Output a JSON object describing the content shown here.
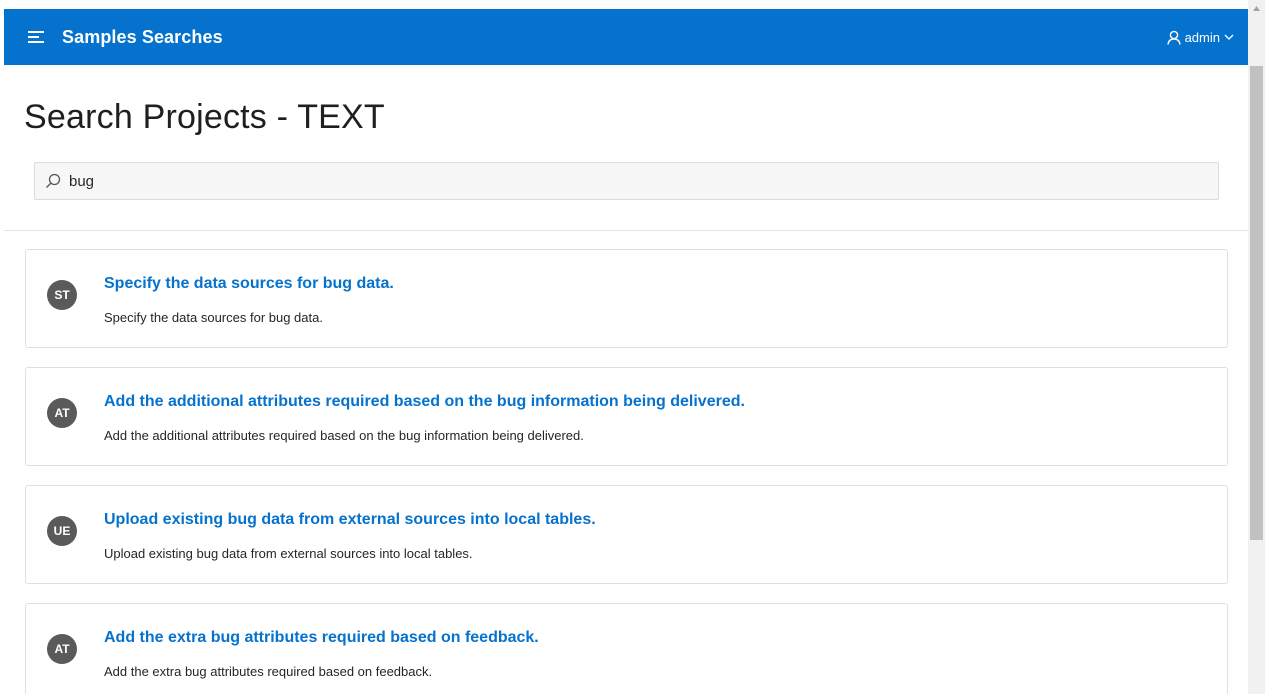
{
  "theme": {
    "accent": "#0572ce",
    "link": "#0572ce",
    "avatar_bg": "#5a5a5a"
  },
  "header": {
    "menu_icon": "hamburger-icon",
    "app_title": "Samples Searches",
    "user_icon": "user-icon",
    "user_name": "admin",
    "user_chevron": "chevron-down-icon"
  },
  "page": {
    "title": "Search Projects - TEXT"
  },
  "search": {
    "icon": "search-icon",
    "value": "bug",
    "placeholder": ""
  },
  "results": [
    {
      "initials": "ST",
      "title": "Specify the data sources for bug data.",
      "description": "Specify the data sources for bug data."
    },
    {
      "initials": "AT",
      "title": "Add the additional attributes required based on the bug information being delivered.",
      "description": "Add the additional attributes required based on the bug information being delivered."
    },
    {
      "initials": "UE",
      "title": "Upload existing bug data from external sources into local tables.",
      "description": "Upload existing bug data from external sources into local tables."
    },
    {
      "initials": "AT",
      "title": "Add the extra bug attributes required based on feedback.",
      "description": "Add the extra bug attributes required based on feedback."
    }
  ]
}
